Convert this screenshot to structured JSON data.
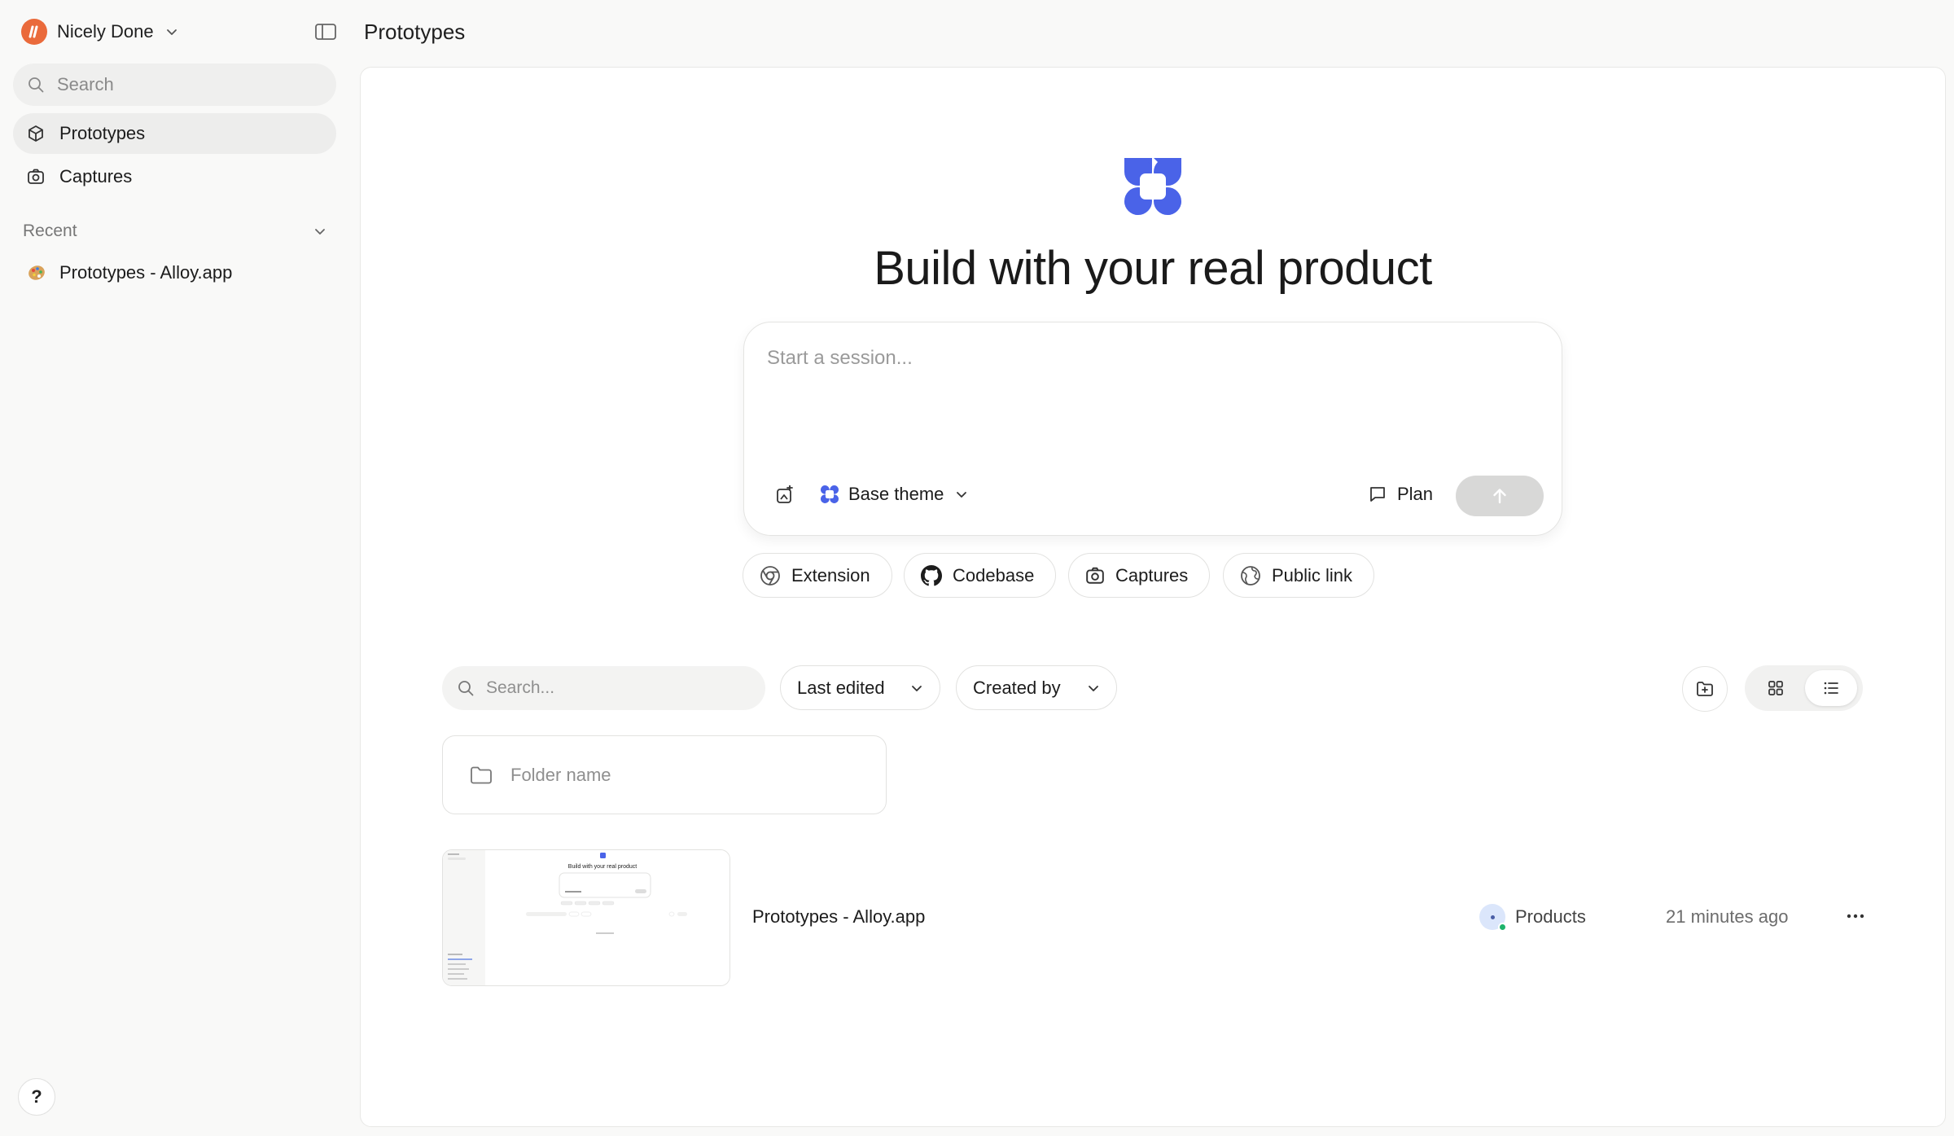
{
  "sidebar": {
    "workspace_name": "Nicely Done",
    "search_placeholder": "Search",
    "nav": [
      {
        "label": "Prototypes",
        "icon": "cube-icon",
        "active": true
      },
      {
        "label": "Captures",
        "icon": "camera-icon",
        "active": false
      }
    ],
    "recent_label": "Recent",
    "recent_items": [
      {
        "label": "Prototypes - Alloy.app",
        "icon": "palette-icon"
      }
    ],
    "help_label": "?"
  },
  "header": {
    "title": "Prototypes"
  },
  "hero": {
    "title": "Build with your real product"
  },
  "composer": {
    "placeholder": "Start a session...",
    "theme_label": "Base theme",
    "plan_label": "Plan"
  },
  "chips": [
    {
      "label": "Extension",
      "icon": "chrome-icon"
    },
    {
      "label": "Codebase",
      "icon": "github-icon"
    },
    {
      "label": "Captures",
      "icon": "camera-icon"
    },
    {
      "label": "Public link",
      "icon": "globe-icon"
    }
  ],
  "filters": {
    "search_placeholder": "Search...",
    "sort_label": "Last edited",
    "created_by_label": "Created by"
  },
  "folder": {
    "placeholder": "Folder name"
  },
  "prototypes": [
    {
      "name": "Prototypes - Alloy.app",
      "owner": "Products",
      "edited": "21 minutes ago",
      "thumb_title": "Build with your real product"
    }
  ],
  "colors": {
    "brand_blue": "#4a63e8",
    "workspace_orange": "#ea6a3b",
    "online_green": "#1db36b"
  }
}
